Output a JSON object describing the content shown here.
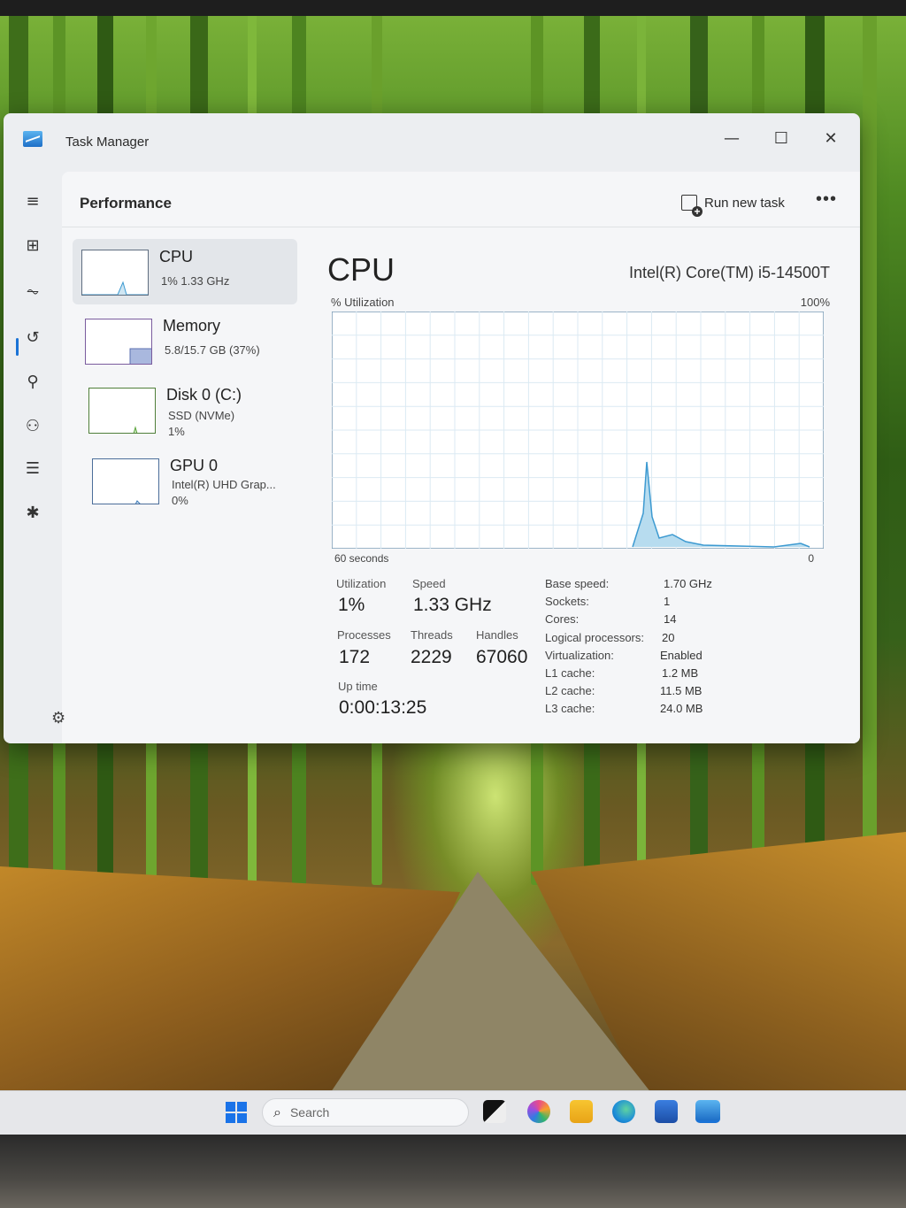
{
  "window": {
    "title": "Task Manager",
    "controls": {
      "minimize": "—",
      "maximize": "☐",
      "close": "✕"
    }
  },
  "header": {
    "page_title": "Performance",
    "run_new_task": "Run new task",
    "more": "•••"
  },
  "sidebar": {
    "items": [
      {
        "icon": "hamburger-menu-icon",
        "glyph": "≡"
      },
      {
        "icon": "processes-icon",
        "glyph": "⊞"
      },
      {
        "icon": "performance-icon",
        "glyph": "⏦"
      },
      {
        "icon": "app-history-icon",
        "glyph": "↺"
      },
      {
        "icon": "startup-apps-icon",
        "glyph": "⚲"
      },
      {
        "icon": "users-icon",
        "glyph": "⚇"
      },
      {
        "icon": "details-icon",
        "glyph": "☰"
      },
      {
        "icon": "services-icon",
        "glyph": "✱"
      }
    ],
    "settings_glyph": "⚙"
  },
  "devices": [
    {
      "name": "CPU",
      "line1": "1% 1.33 GHz",
      "line2": ""
    },
    {
      "name": "Memory",
      "line1": "5.8/15.7 GB (37%)",
      "line2": ""
    },
    {
      "name": "Disk 0 (C:)",
      "line1": "SSD (NVMe)",
      "line2": "1%"
    },
    {
      "name": "GPU 0",
      "line1": "Intel(R) UHD Grap...",
      "line2": "0%"
    }
  ],
  "cpu": {
    "heading": "CPU",
    "model": "Intel(R) Core(TM) i5-14500T",
    "utilization_label": "% Utilization",
    "max_label": "100%",
    "time_label": "60 seconds",
    "min_label": "0",
    "stats": {
      "utilization_label": "Utilization",
      "utilization": "1%",
      "speed_label": "Speed",
      "speed": "1.33 GHz",
      "processes_label": "Processes",
      "processes": "172",
      "threads_label": "Threads",
      "threads": "2229",
      "handles_label": "Handles",
      "handles": "67060",
      "uptime_label": "Up time",
      "uptime": "0:00:13:25"
    },
    "specs": [
      {
        "label": "Base speed:",
        "value": "1.70 GHz"
      },
      {
        "label": "Sockets:",
        "value": "1"
      },
      {
        "label": "Cores:",
        "value": "14"
      },
      {
        "label": "Logical processors:",
        "value": "20"
      },
      {
        "label": "Virtualization:",
        "value": "Enabled"
      },
      {
        "label": "L1 cache:",
        "value": "1.2 MB"
      },
      {
        "label": "L2 cache:",
        "value": "11.5 MB"
      },
      {
        "label": "L3 cache:",
        "value": "24.0 MB"
      }
    ]
  },
  "taskbar": {
    "search_placeholder": "Search",
    "search_glyph": "⌕"
  },
  "colors": {
    "accent": "#1a73d6",
    "graph_line": "#3d9ad1",
    "graph_fill": "#b7dcef",
    "grid": "#d9ecf5"
  }
}
